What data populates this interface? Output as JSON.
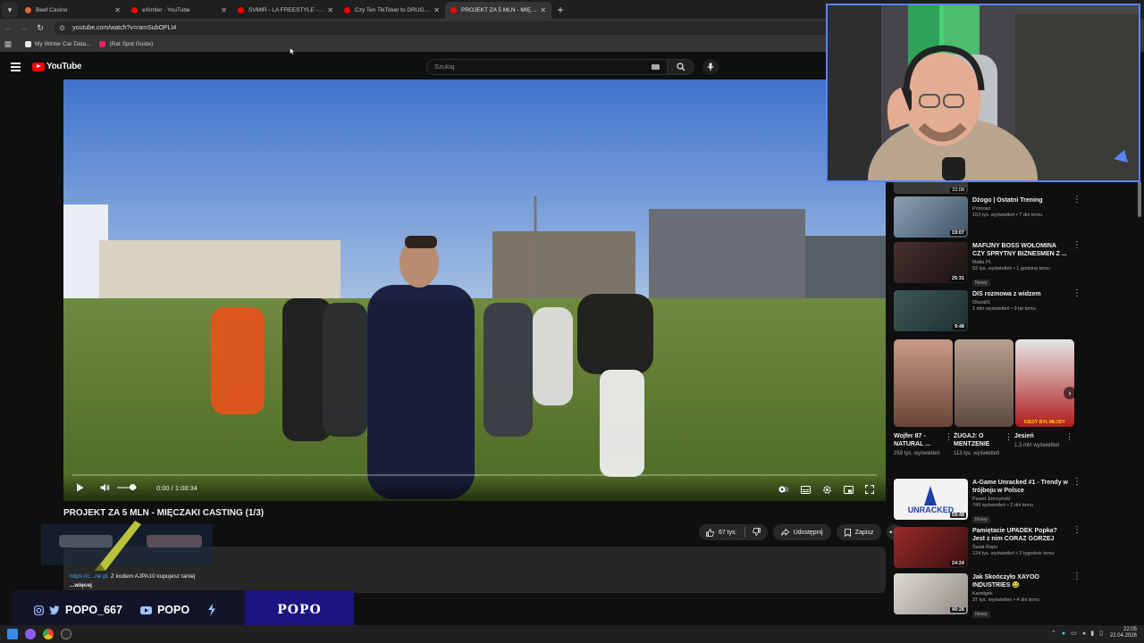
{
  "browser": {
    "tabs": [
      {
        "label": "Beef Casino",
        "favicon_color": "#e5673b",
        "active": false
      },
      {
        "label": "eXmiter - YouTube",
        "favicon_color": "#ff0000",
        "active": false
      },
      {
        "label": "SVMIR - LA FREESTYLE - YouTube",
        "favicon_color": "#ff0000",
        "active": false
      },
      {
        "label": "Czy Ten TikToker to DRUGI Dani...",
        "favicon_color": "#ff0000",
        "active": false
      },
      {
        "label": "PROJEKT ZA 5 MLN - MIĘCZAKI...",
        "favicon_color": "#ff0000",
        "active": true
      }
    ],
    "url": "youtube.com/watch?v=ramSubOPLI4",
    "bookmarks": [
      {
        "label": "My Winter Car Data...",
        "icon_color": "#e8e8e8"
      },
      {
        "label": "(Rat Spot Guide)",
        "icon_color": "#e0245e"
      }
    ]
  },
  "youtube": {
    "logo_text": "YouTube",
    "search_placeholder": "Szukaj"
  },
  "player": {
    "time": "0:00 / 1:08:34"
  },
  "video": {
    "title": "PROJEKT ZA 5 MLN - MIĘCZAKI CASTING (1/3)",
    "likes": "67 tys.",
    "share_label": "Udostępnij",
    "save_label": "Zapisz",
    "desc_link": "https://c...ne.pl.",
    "desc_text": " Z kodem AJPA10 kupujesz taniej",
    "desc_more": "...więcej"
  },
  "stream_banner": {
    "username": "POPO_667",
    "channel": "POPO",
    "logo_text": "POPO"
  },
  "sidebar": {
    "top_duration": "22:08",
    "recs": [
      {
        "title": "Dżogo | Ostatni Trening",
        "channel": "Pronosz",
        "meta": "153 tys. wyświetleń • 7 dni temu",
        "badge": "",
        "duration": "19:07",
        "thumb_color": "#5b6e82"
      },
      {
        "title": "MAFIJNY BOSS WOŁOMINA CZY SPRYTNY BIZNESMEN Z ...",
        "channel": "Mafia PL",
        "meta": "53 tys. wyświetleń • 1 godzinę temu",
        "badge": "Nowy",
        "duration": "25:31",
        "thumb_color": "#3b2a2a"
      },
      {
        "title": "DIS rozmowa z widzem",
        "channel": "Olsza01",
        "meta": "1 mln wyświetleń • 9 lat temu",
        "badge": "",
        "duration": "9:48",
        "thumb_color": "#2f4a4a"
      },
      {
        "title": "A-Game Unracked #1 - Trendy w trójboju w Polsce",
        "channel": "Paweł Jurczyński",
        "meta": "749 wyświetleń • 2 dni temu",
        "badge": "Nowy",
        "duration": "59:48",
        "thumb_color": "#f2f2f2"
      },
      {
        "title": "Pamiętacie UPADEK Popka? Jest z nim CORAZ GORZEJ",
        "channel": "Świat Rapu",
        "meta": "124 tys. wyświetleń • 2 tygodnie temu",
        "badge": "",
        "duration": "24:24",
        "thumb_color": "#7a1e1e"
      },
      {
        "title": "Jak Skończyło XAYOO INDUSTRIES 😂",
        "channel": "Kamiłgek",
        "meta": "37 tys. wyświetleń • 4 dni temu",
        "badge": "Nowy",
        "duration": "40:26",
        "thumb_color": "#c9c6c0"
      }
    ],
    "shorts": [
      {
        "title": "Wojfer 87 - NATURAL ...",
        "views": "259 tys. wyświetleń",
        "color": "#b07a66"
      },
      {
        "title": "ŻUGAJ: O MENTZENIE",
        "views": "113 tys. wyświetleń",
        "color": "#9c8a7e"
      },
      {
        "title": "Jesień",
        "views": "1,3 mln wyświetleń",
        "color": "#d7d7d7"
      }
    ],
    "short_caption": "KIEDY BYŁ MŁODY"
  },
  "taskbar": {
    "time": "22:05",
    "date": "22.04.2026"
  },
  "colors": {
    "yt_bg": "#0f0f0f",
    "yt_red": "#ff0000",
    "webcam_border": "#5a84ff",
    "banner_left": "#13132a",
    "banner_right": "#1c1480"
  }
}
